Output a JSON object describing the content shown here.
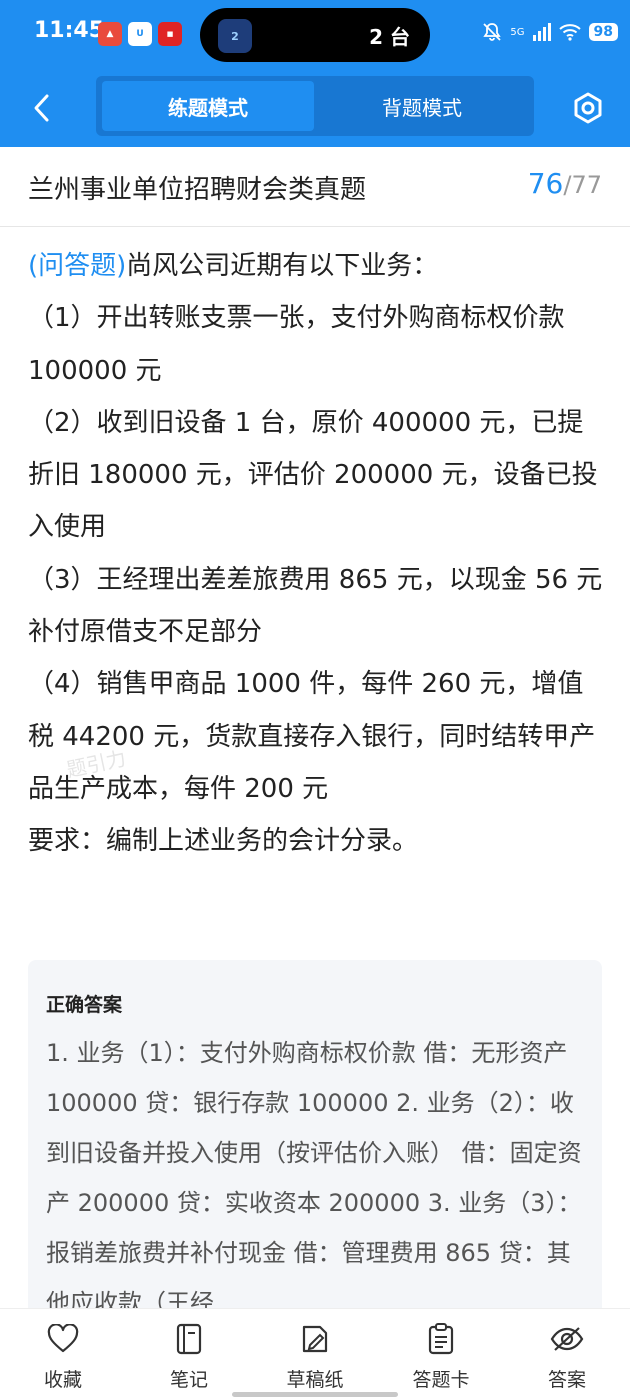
{
  "status_bar": {
    "time": "11:45",
    "island_badge": "2",
    "island_text": "2 台",
    "network": "5G",
    "battery": "98"
  },
  "nav": {
    "active_tab": "练题模式",
    "inactive_tab": "背题模式"
  },
  "header": {
    "title": "兰州事业单位招聘财会类真题",
    "current": "76",
    "separator": "/",
    "total": "77"
  },
  "question": {
    "type_label": "(问答题)",
    "intro": "尚风公司近期有以下业务：",
    "items": [
      "（1）开出转账支票一张，支付外购商标权价款 100000 元",
      "（2）收到旧设备 1 台，原价 400000 元，已提折旧 180000 元，评估价 200000 元，设备已投入使用",
      "（3）王经理出差差旅费用 865 元，以现金 56 元补付原借支不足部分",
      "（4）销售甲商品 1000 件，每件 260 元，增值税 44200 元，货款直接存入银行，同时结转甲产品生产成本，每件 200 元"
    ],
    "requirement": "要求：编制上述业务的会计分录。"
  },
  "watermark": "题引力",
  "answer": {
    "title": "正确答案",
    "text": "1. 业务（1）：支付外购商标权价款 借：无形资产 100000 贷：银行存款 100000 2. 业务（2）：收到旧设备并投入使用（按评估价入账） 借：固定资产 200000 贷：实收资本 200000 3. 业务（3）：报销差旅费并补付现金 借：管理费用 865 贷：其他应收款（王经"
  },
  "bottom_bar": {
    "items": [
      {
        "label": "收藏",
        "icon": "heart-icon"
      },
      {
        "label": "笔记",
        "icon": "notebook-icon"
      },
      {
        "label": "草稿纸",
        "icon": "draft-icon"
      },
      {
        "label": "答题卡",
        "icon": "answer-card-icon"
      },
      {
        "label": "答案",
        "icon": "eye-off-icon"
      }
    ]
  },
  "colors": {
    "brand": "#1f8ef1",
    "answer_bg": "#f4f6f9"
  }
}
